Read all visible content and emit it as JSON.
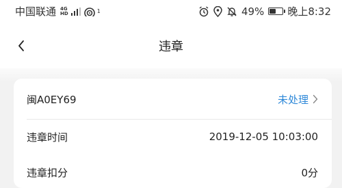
{
  "status_bar": {
    "carrier": "中国联通",
    "network_top": "4G",
    "network_bottom": "HD",
    "wifi_sup": "1",
    "battery_text": "49%",
    "battery_level": 0.49,
    "time": "晚上8:32"
  },
  "header": {
    "title": "违章"
  },
  "violation": {
    "plate": "闽A0EY69",
    "status_label": "未处理",
    "time_label": "违章时间",
    "time_value": "2019-12-05 10:03:00",
    "points_label": "违章扣分",
    "points_value": "0分"
  },
  "colors": {
    "accent": "#2e88d8"
  }
}
